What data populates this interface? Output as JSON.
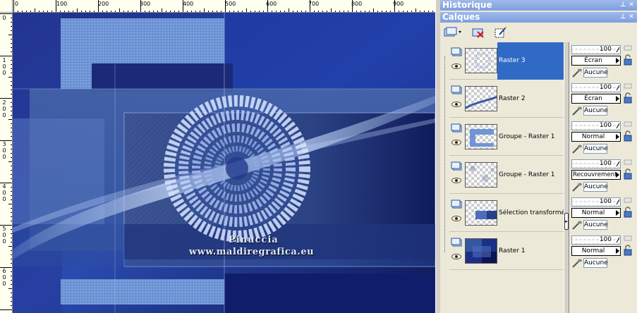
{
  "ruler": {
    "top_labels": [
      "0",
      "100",
      "200",
      "300",
      "400",
      "500",
      "600",
      "700",
      "800",
      "900"
    ],
    "left_labels": [
      [
        "0"
      ],
      [
        "1",
        "0",
        "0"
      ],
      [
        "2",
        "0",
        "0"
      ],
      [
        "3",
        "0",
        "0"
      ],
      [
        "4",
        "0",
        "0"
      ],
      [
        "5",
        "0",
        "0"
      ],
      [
        "6",
        "0",
        "0"
      ]
    ]
  },
  "canvas": {
    "watermark_line1": "Pinuccia",
    "watermark_line2": "www.maldiregrafica.eu"
  },
  "panels": {
    "history_title": "Historique",
    "layers_title": "Calques"
  },
  "layers": [
    {
      "name": "Raster 3",
      "opacity": "100",
      "blend": "Écran",
      "mask": "Aucune",
      "selected": true
    },
    {
      "name": "Raster 2",
      "opacity": "100",
      "blend": "Écran",
      "mask": "Aucune",
      "selected": false
    },
    {
      "name": "Groupe - Raster 1",
      "opacity": "100",
      "blend": "Normal",
      "mask": "Aucune",
      "selected": false
    },
    {
      "name": "Groupe - Raster 1",
      "opacity": "100",
      "blend": "Recouvrement",
      "mask": "Aucune",
      "selected": false
    },
    {
      "name": "Sélection transformée",
      "opacity": "100",
      "blend": "Normal",
      "mask": "Aucune",
      "selected": false
    },
    {
      "name": "Raster 1",
      "opacity": "100",
      "blend": "Normal",
      "mask": "Aucune",
      "selected": false
    }
  ],
  "colors": {
    "selection": "#316ac5",
    "palette_bar": "#8aa8e3",
    "panel_bg": "#ece9d8"
  }
}
